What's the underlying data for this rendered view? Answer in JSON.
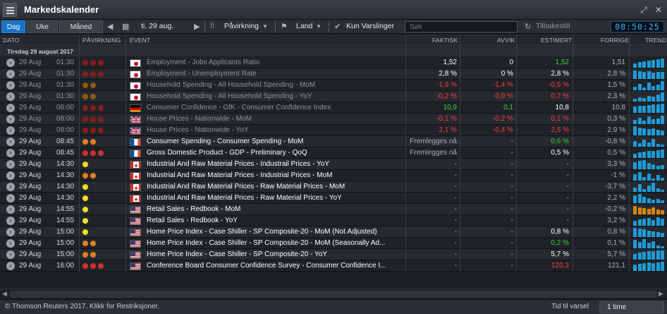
{
  "app": {
    "title": "Markedskalender",
    "clock": "08:50:25"
  },
  "toolbar": {
    "day": "Dag",
    "week": "Uke",
    "month": "Måned",
    "date": "ti. 29 aug.",
    "impact": "Påvirkning",
    "country": "Land",
    "alerts": "Kun Varslinger",
    "search_placeholder": "Søk",
    "reset": "Tilbakestill"
  },
  "columns": {
    "date": "DATO",
    "impact": "PÅVIRKNING",
    "event": "EVENT",
    "actual": "FAKTISK",
    "deviation": "AVVIK",
    "estimate": "ESTIMERT",
    "previous": "FORRIGE",
    "trend": "TREND"
  },
  "group_date": "Tirsdag 29 august 2017",
  "colors": {
    "red": "#d03030",
    "orange": "#e08020",
    "yellow": "#f0e020",
    "pos": "#3bd13b",
    "neg": "#ff3b3b",
    "trend_blue": "#1e9bd7",
    "trend_orange": "#d8860c"
  },
  "rows": [
    {
      "date": "29 Aug",
      "time": "01:30",
      "impact": "high",
      "country": "jp",
      "event": "Employment - Jobs Applicants Ratio",
      "actual": "1,52",
      "actual_c": "w",
      "dev": "0",
      "dev_c": "w",
      "est": "1,52",
      "est_c": "g",
      "prev": "1,51",
      "past": true,
      "trend": [
        6,
        8,
        9,
        10,
        11,
        12,
        13
      ],
      "trend_c": "b"
    },
    {
      "date": "29 Aug",
      "time": "01:30",
      "impact": "high",
      "country": "jp",
      "event": "Employment - Unemployment Rate",
      "actual": "2,8 %",
      "actual_c": "w",
      "dev": "0 %",
      "dev_c": "w",
      "est": "2,8 %",
      "est_c": "w",
      "prev": "2,8 %",
      "past": true,
      "trend": [
        12,
        11,
        10,
        11,
        9,
        10,
        10
      ],
      "trend_c": "b"
    },
    {
      "date": "29 Aug",
      "time": "01:30",
      "impact": "med",
      "country": "jp",
      "event": "Household Spending - All Household Spending - MoM",
      "actual": "-1,9 %",
      "actual_c": "r",
      "dev": "-1,4 %",
      "dev_c": "r",
      "est": "-0,5 %",
      "est_c": "r",
      "prev": "1,5 %",
      "past": true,
      "trend": [
        5,
        9,
        4,
        11,
        6,
        8,
        13
      ],
      "trend_c": "b"
    },
    {
      "date": "29 Aug",
      "time": "01:30",
      "impact": "med",
      "country": "jp",
      "event": "Household Spending - All Household Spending - YoY",
      "actual": "-0,2 %",
      "actual_c": "r",
      "dev": "-0,9 %",
      "dev_c": "r",
      "est": "0,7 %",
      "est_c": "r",
      "prev": "2,3 %",
      "past": true,
      "trend": [
        4,
        6,
        5,
        8,
        7,
        10,
        13
      ],
      "trend_c": "b"
    },
    {
      "date": "29 Aug",
      "time": "08:00",
      "impact": "high",
      "country": "de",
      "event": "Consumer Confidence - GfK - Consumer Confidence Index",
      "actual": "10,9",
      "actual_c": "g",
      "dev": "0,1",
      "dev_c": "g",
      "est": "10,8",
      "est_c": "w",
      "prev": "10,8",
      "past": true,
      "trend": [
        9,
        10,
        10,
        11,
        12,
        12,
        13
      ],
      "trend_c": "b"
    },
    {
      "date": "29 Aug",
      "time": "08:00",
      "impact": "high",
      "country": "gb",
      "event": "House Prices - Nationwide - MoM",
      "actual": "-0,1 %",
      "actual_c": "r",
      "dev": "-0,2 %",
      "dev_c": "r",
      "est": "0,1 %",
      "est_c": "r",
      "prev": "0,3 %",
      "past": true,
      "trend": [
        6,
        9,
        5,
        11,
        7,
        8,
        12
      ],
      "trend_c": "b"
    },
    {
      "date": "29 Aug",
      "time": "08:00",
      "impact": "high",
      "country": "gb",
      "event": "House Prices - Nationwide - YoY",
      "actual": "2,1 %",
      "actual_c": "r",
      "dev": "-0,4 %",
      "dev_c": "r",
      "est": "2,5 %",
      "est_c": "r",
      "prev": "2,9 %",
      "past": true,
      "trend": [
        13,
        11,
        10,
        9,
        10,
        8,
        7
      ],
      "trend_c": "b"
    },
    {
      "date": "29 Aug",
      "time": "08:45",
      "impact": "med",
      "country": "fr",
      "event": "Consumer Spending - Consumer Spending - MoM",
      "actual": "Fremlegges nå",
      "actual_c": "m",
      "dev": "-",
      "dev_c": "m",
      "est": "0,6 %",
      "est_c": "g",
      "prev": "-0,8 %",
      "past": false,
      "trend": [
        8,
        5,
        10,
        6,
        11,
        4,
        3
      ],
      "trend_c": "b"
    },
    {
      "date": "29 Aug",
      "time": "08:45",
      "impact": "high",
      "country": "fr",
      "event": "Gross Domestic Product - GDP - Preliminary - QoQ",
      "actual": "Fremlegges nå",
      "actual_c": "m",
      "dev": "-",
      "dev_c": "m",
      "est": "0,5 %",
      "est_c": "w",
      "prev": "0,5 %",
      "past": false,
      "trend": [
        6,
        8,
        9,
        10,
        10,
        11,
        12
      ],
      "trend_c": "b"
    },
    {
      "date": "29 Aug",
      "time": "14:30",
      "impact": "low",
      "country": "ca",
      "event": "Industrial And Raw Material Prices - Industrail Prices - YoY",
      "actual": "-",
      "actual_c": "m",
      "dev": "-",
      "dev_c": "m",
      "est": "-",
      "est_c": "m",
      "prev": "3,3 %",
      "past": false,
      "trend": [
        10,
        12,
        13,
        9,
        7,
        5,
        6
      ],
      "trend_c": "b"
    },
    {
      "date": "29 Aug",
      "time": "14:30",
      "impact": "med",
      "country": "ca",
      "event": "Industrial And Raw Material Prices - Industrial Prices - MoM",
      "actual": "-",
      "actual_c": "m",
      "dev": "-",
      "dev_c": "m",
      "est": "-",
      "est_c": "m",
      "prev": "-1 %",
      "past": false,
      "trend": [
        9,
        12,
        5,
        10,
        3,
        8,
        4
      ],
      "trend_c": "b"
    },
    {
      "date": "29 Aug",
      "time": "14:30",
      "impact": "low",
      "country": "ca",
      "event": "Industrial And Raw Material Prices - Raw Material Prices - MoM",
      "actual": "-",
      "actual_c": "m",
      "dev": "-",
      "dev_c": "m",
      "est": "-",
      "est_c": "m",
      "prev": "-3,7 %",
      "past": false,
      "trend": [
        6,
        11,
        4,
        9,
        13,
        5,
        3
      ],
      "trend_c": "b"
    },
    {
      "date": "29 Aug",
      "time": "14:30",
      "impact": "low",
      "country": "ca",
      "event": "Industrial And Raw Material Prices - Raw Material Prices - YoY",
      "actual": "-",
      "actual_c": "m",
      "dev": "-",
      "dev_c": "m",
      "est": "-",
      "est_c": "m",
      "prev": "2,2 %",
      "past": false,
      "trend": [
        11,
        13,
        9,
        7,
        5,
        6,
        4
      ],
      "trend_c": "b"
    },
    {
      "date": "29 Aug",
      "time": "14:55",
      "impact": "low",
      "country": "us",
      "event": "Retail Sales - Redbook - MoM",
      "actual": "-",
      "actual_c": "m",
      "dev": "-",
      "dev_c": "m",
      "est": "-",
      "est_c": "m",
      "prev": "-0,2 %",
      "past": false,
      "trend": [
        12,
        10,
        9,
        8,
        10,
        7,
        6
      ],
      "trend_c": "o"
    },
    {
      "date": "29 Aug",
      "time": "14:55",
      "impact": "low",
      "country": "us",
      "event": "Retail Sales - Redbook - YoY",
      "actual": "-",
      "actual_c": "m",
      "dev": "-",
      "dev_c": "m",
      "est": "-",
      "est_c": "m",
      "prev": "3,2 %",
      "past": false,
      "trend": [
        7,
        9,
        10,
        11,
        8,
        12,
        10
      ],
      "trend_c": "b"
    },
    {
      "date": "29 Aug",
      "time": "15:00",
      "impact": "low",
      "country": "us",
      "event": "Home Price Index - Case Shiller - SP Composite-20 - MoM (Not Adjusted)",
      "actual": "-",
      "actual_c": "m",
      "dev": "-",
      "dev_c": "m",
      "est": "0,8 %",
      "est_c": "w",
      "prev": "0,8 %",
      "past": false,
      "trend": [
        13,
        12,
        11,
        9,
        8,
        7,
        6
      ],
      "trend_c": "b"
    },
    {
      "date": "29 Aug",
      "time": "15:00",
      "impact": "med",
      "country": "us",
      "event": "Home Price Index - Case Shiller - SP Composite-20 - MoM (Seasonally Ad...",
      "actual": "-",
      "actual_c": "m",
      "dev": "-",
      "dev_c": "m",
      "est": "0,2 %",
      "est_c": "g",
      "prev": "0,1 %",
      "past": false,
      "trend": [
        12,
        9,
        13,
        8,
        10,
        4,
        3
      ],
      "trend_c": "b"
    },
    {
      "date": "29 Aug",
      "time": "15:00",
      "impact": "med",
      "country": "us",
      "event": "Home Price Index - Case Shiller - SP Composite-20 - YoY",
      "actual": "-",
      "actual_c": "m",
      "dev": "-",
      "dev_c": "m",
      "est": "5,7 %",
      "est_c": "w",
      "prev": "5,7 %",
      "past": false,
      "trend": [
        8,
        10,
        11,
        12,
        12,
        13,
        13
      ],
      "trend_c": "b"
    },
    {
      "date": "29 Aug",
      "time": "16:00",
      "impact": "high",
      "country": "us",
      "event": "Conference Board Consumer Confidence Survey - Consumer Confidence I...",
      "actual": "-",
      "actual_c": "m",
      "dev": "-",
      "dev_c": "m",
      "est": "120,3",
      "est_c": "r",
      "prev": "121,1",
      "past": false,
      "trend": [
        9,
        10,
        11,
        12,
        11,
        12,
        13
      ],
      "trend_c": "b"
    }
  ],
  "footer": {
    "copyright": "© Thomson Reuters 2017. Klikk for Restriksjoner.",
    "alert_label": "Tid til varsel",
    "alert_value": "1 time"
  }
}
